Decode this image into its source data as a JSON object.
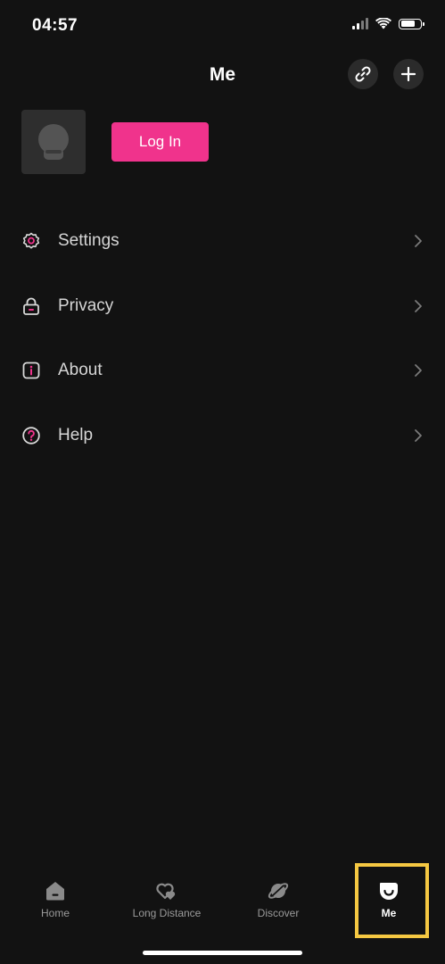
{
  "status_bar": {
    "time": "04:57",
    "battery_percent": 75
  },
  "header": {
    "title": "Me"
  },
  "profile": {
    "login_label": "Log In"
  },
  "menu": [
    {
      "label": "Settings",
      "icon": "gear-icon"
    },
    {
      "label": "Privacy",
      "icon": "lock-icon"
    },
    {
      "label": "About",
      "icon": "info-icon"
    },
    {
      "label": "Help",
      "icon": "help-icon"
    }
  ],
  "tabs": [
    {
      "label": "Home",
      "icon": "home-icon"
    },
    {
      "label": "Long Distance",
      "icon": "hearts-icon"
    },
    {
      "label": "Discover",
      "icon": "planet-icon"
    },
    {
      "label": "Me",
      "icon": "smile-icon",
      "active": true
    }
  ],
  "colors": {
    "accent": "#f0338c",
    "background": "#121212",
    "highlight": "#f5c842"
  }
}
